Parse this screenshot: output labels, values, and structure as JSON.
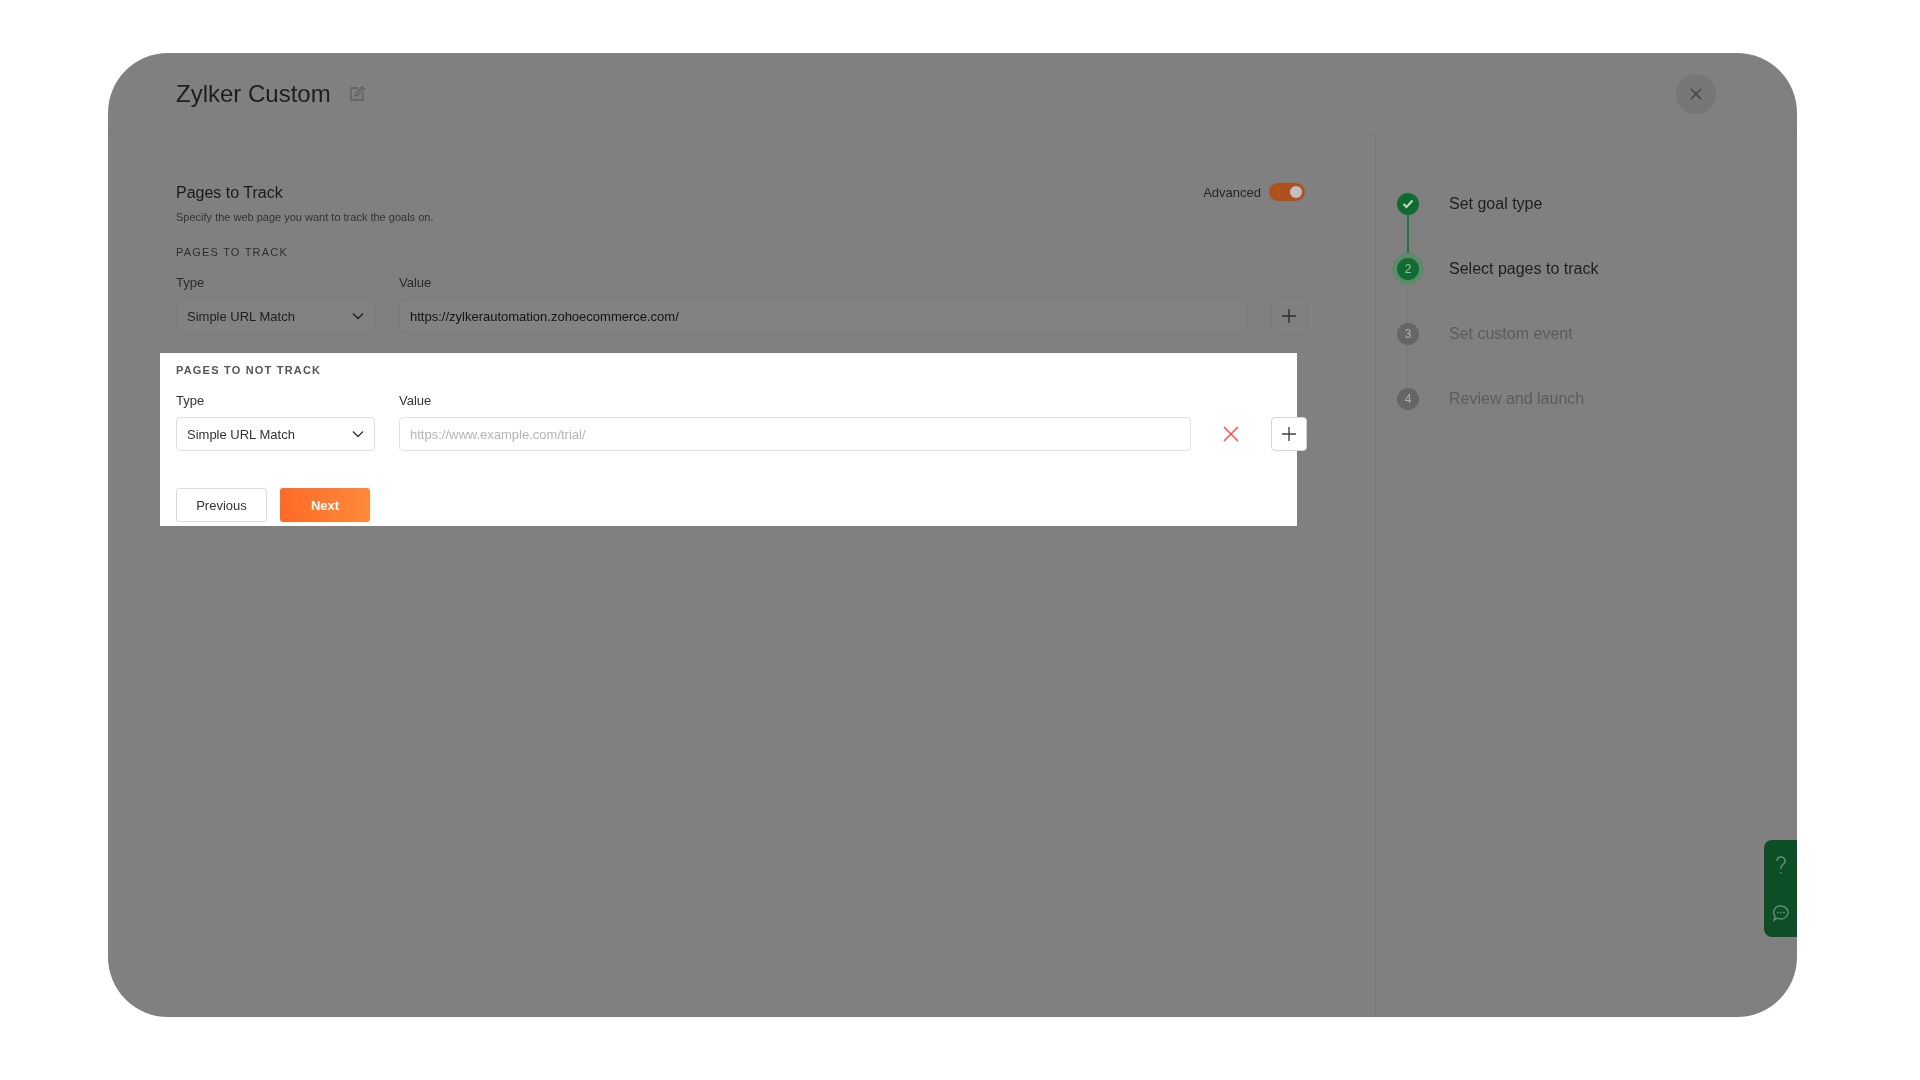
{
  "window": {
    "title": "Zylker Custom"
  },
  "section": {
    "title": "Pages to Track",
    "subtitle": "Specify the web page you want to track the goals on.",
    "advanced": {
      "label": "Advanced",
      "on": true
    }
  },
  "groups": [
    {
      "heading": "PAGES TO TRACK",
      "highlighted": false,
      "type_label": "Type",
      "type_value": "Simple URL Match",
      "value_label": "Value",
      "value": "https://zylkerautomation.zohoecommerce.com/",
      "removable": false
    },
    {
      "heading": "PAGES TO NOT TRACK",
      "highlighted": true,
      "type_label": "Type",
      "type_value": "Simple URL Match",
      "value_label": "Value",
      "placeholder": "https://www.example.com/trial/",
      "removable": true
    }
  ],
  "buttons": [
    {
      "label": "Previous",
      "kind": "secondary"
    },
    {
      "label": "Next",
      "kind": "primary"
    }
  ],
  "steps": [
    {
      "label": "Set goal type",
      "completed": true,
      "selected": false
    },
    {
      "number": "2",
      "label": "Select pages to track",
      "completed": false,
      "selected": true
    },
    {
      "number": "3",
      "label": "Set custom event",
      "completed": false,
      "selected": false
    },
    {
      "number": "4",
      "label": "Review and launch",
      "completed": false,
      "selected": false
    }
  ]
}
